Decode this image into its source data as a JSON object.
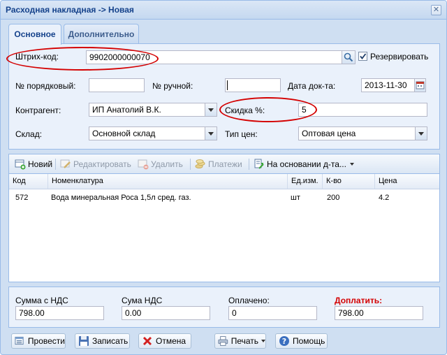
{
  "window": {
    "title": "Расходная накладная -> Новая",
    "close_glyph": "✕"
  },
  "tabs": [
    {
      "label": "Основное",
      "active": true
    },
    {
      "label": "Дополнительно",
      "active": false
    }
  ],
  "form": {
    "barcode_label": "Штрих-код:",
    "barcode_value": "9902000000070",
    "reserve_label": "Резервировать",
    "reserve_checked": true,
    "seq_number_label": "№ порядковый:",
    "seq_number_value": "",
    "manual_number_label": "№ ручной:",
    "manual_number_value": "",
    "doc_date_label": "Дата док-та:",
    "doc_date_value": "2013-11-30",
    "counterparty_label": "Контрагент:",
    "counterparty_value": "ИП Анатолий В.К.",
    "discount_label": "Скидка %:",
    "discount_value": "5",
    "warehouse_label": "Склад:",
    "warehouse_value": "Основной склад",
    "price_type_label": "Тип цен:",
    "price_type_value": "Оптовая цена"
  },
  "toolbar": {
    "new_label": "Новий",
    "edit_label": "Редактировать",
    "delete_label": "Удалить",
    "payments_label": "Платежи",
    "based_on_label": "На основании д-та..."
  },
  "grid": {
    "columns": [
      "Код",
      "Номенклатура",
      "Ед.изм.",
      "К-во",
      "Цена"
    ],
    "rows": [
      [
        "572",
        "Вода минеральная Роса 1,5л сред. газ.",
        "шт",
        "200",
        "4.2"
      ]
    ]
  },
  "totals": {
    "sum_vat_label": "Сумма с НДС",
    "sum_vat_value": "798.00",
    "vat_label": "Сума НДС",
    "vat_value": "0.00",
    "paid_label": "Оплачено:",
    "paid_value": "0",
    "topay_label": "Доплатить:",
    "topay_value": "798.00"
  },
  "buttons": {
    "post_label": "Провести",
    "save_label": "Записать",
    "cancel_label": "Отмена",
    "print_label": "Печать",
    "help_label": "Помощь"
  },
  "colors": {
    "accent": "#15428b",
    "topay_label": "#d40000",
    "annotation": "#d40000"
  }
}
